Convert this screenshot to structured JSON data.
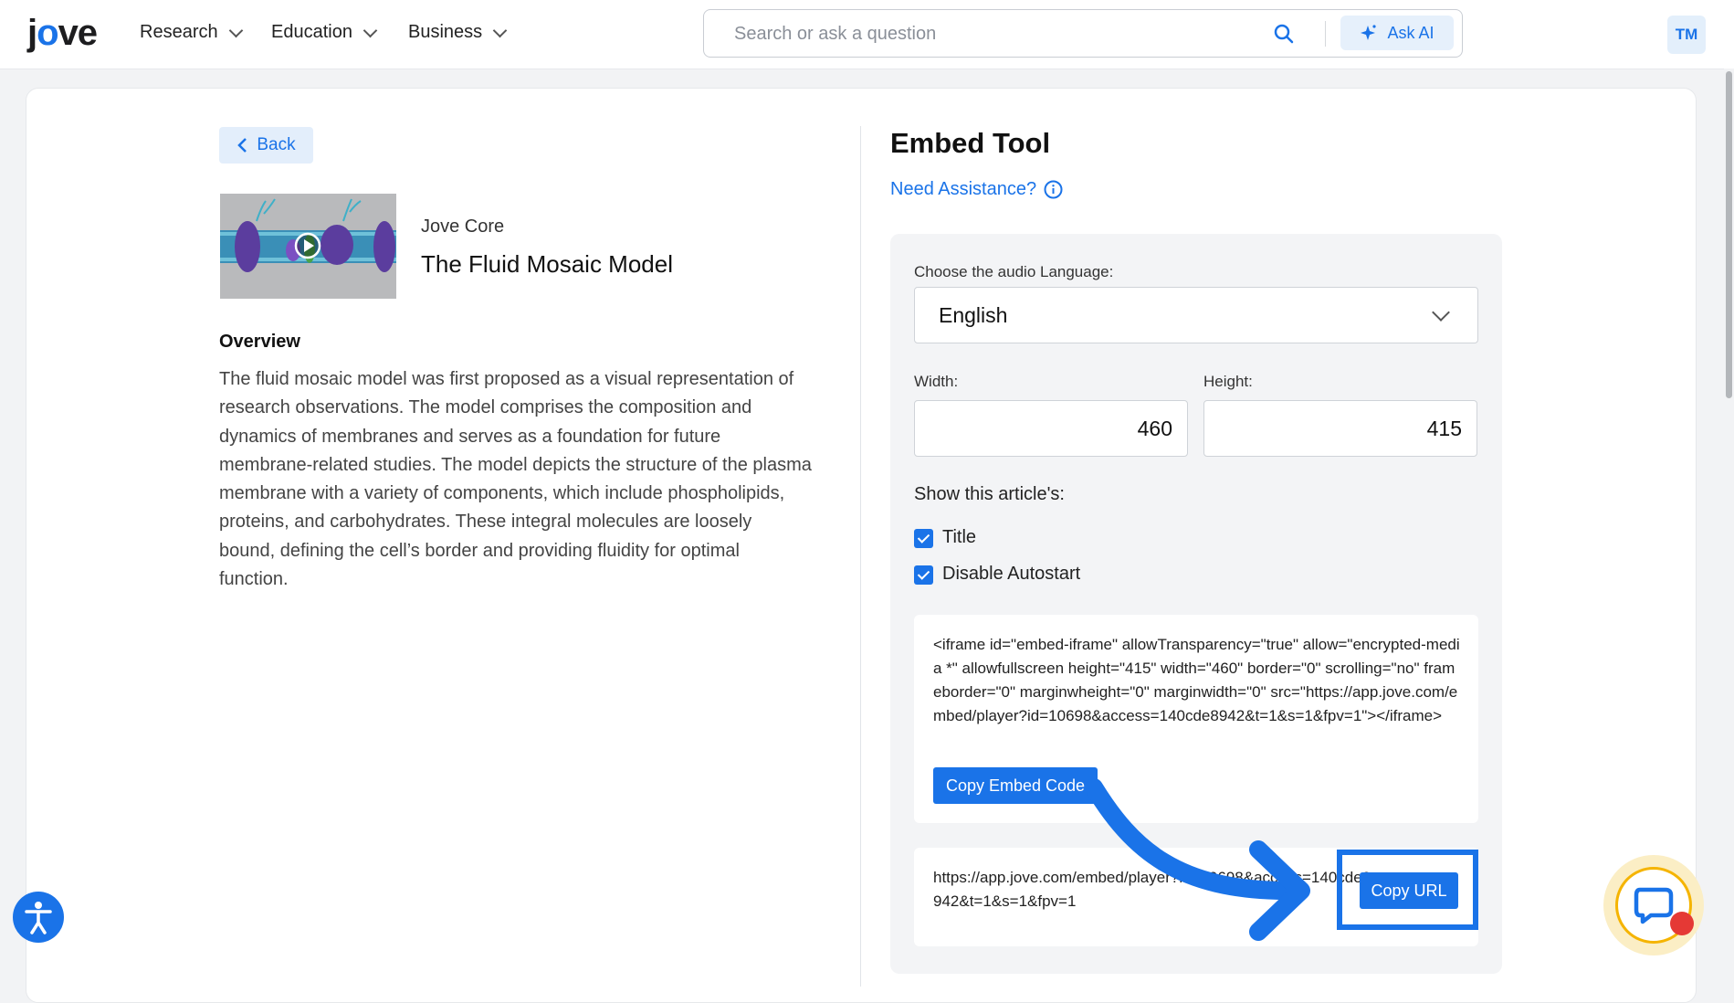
{
  "header": {
    "logo": "jove",
    "nav": [
      {
        "label": "Research"
      },
      {
        "label": "Education"
      },
      {
        "label": "Business"
      }
    ],
    "search_placeholder": "Search or ask a question",
    "ask_ai_label": "Ask AI",
    "avatar_initials": "TM"
  },
  "left": {
    "back_label": "Back",
    "series": "Jove Core",
    "title": "The Fluid Mosaic Model",
    "overview_heading": "Overview",
    "overview_text": "The fluid mosaic model was first proposed as a visual representation of research observations. The model comprises the composition and dynamics of membranes and serves as a foundation for future membrane-related studies. The model depicts the structure of the plasma membrane with a variety of components, which include phospholipids, proteins, and carbohydrates. These integral molecules are loosely bound, defining the cell’s border and providing fluidity for optimal function."
  },
  "embed": {
    "heading": "Embed Tool",
    "assistance_label": "Need Assistance?",
    "language_label": "Choose the audio Language:",
    "language_value": "English",
    "width_label": "Width:",
    "width_value": "460",
    "height_label": "Height:",
    "height_value": "415",
    "show_heading": "Show this article's:",
    "options": [
      {
        "label": "Title",
        "checked": true
      },
      {
        "label": "Disable Autostart",
        "checked": true
      }
    ],
    "embed_code": "<iframe id=\"embed-iframe\" allowTransparency=\"true\" allow=\"encrypted-media *\" allowfullscreen height=\"415\" width=\"460\" border=\"0\" scrolling=\"no\" frameborder=\"0\" marginwheight=\"0\" marginwidth=\"0\" src=\"https://app.jove.com/embed/player?id=10698&access=140cde8942&t=1&s=1&fpv=1\"></iframe>",
    "copy_embed_label": "Copy Embed Code",
    "url": "https://app.jove.com/embed/player?id=10698&access=140cde8942&t=1&s=1&fpv=1",
    "copy_url_label": "Copy URL"
  },
  "colors": {
    "accent": "#1a73e8",
    "chat_ring": "#f5b400",
    "notify": "#e53935"
  }
}
